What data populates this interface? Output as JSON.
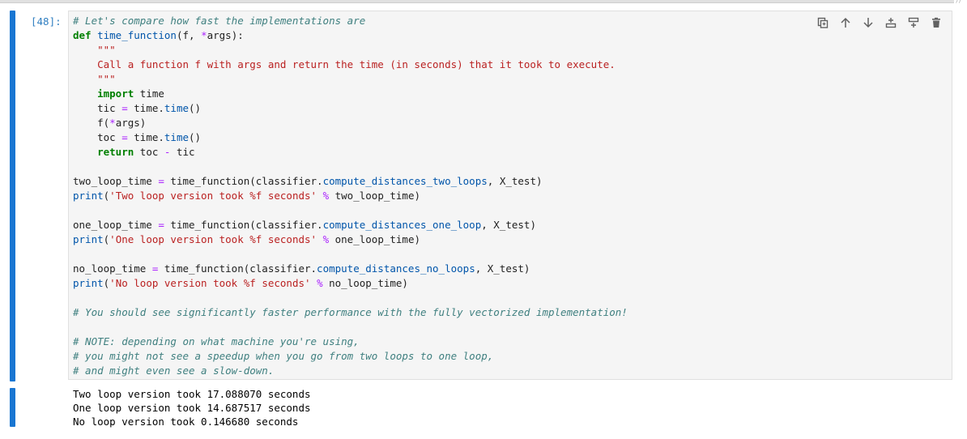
{
  "cell": {
    "prompt": "[48]:",
    "code_lines": [
      [
        {
          "t": "c",
          "v": "# Let's compare how fast the implementations are"
        }
      ],
      [
        {
          "t": "k",
          "v": "def"
        },
        {
          "t": "n",
          "v": " "
        },
        {
          "t": "f",
          "v": "time_function"
        },
        {
          "t": "n",
          "v": "(f, "
        },
        {
          "t": "o",
          "v": "*"
        },
        {
          "t": "n",
          "v": "args):"
        }
      ],
      [
        {
          "t": "s",
          "v": "    \"\"\""
        }
      ],
      [
        {
          "t": "s",
          "v": "    Call a function f with args and return the time (in seconds) that it took to execute."
        }
      ],
      [
        {
          "t": "s",
          "v": "    \"\"\""
        }
      ],
      [
        {
          "t": "n",
          "v": "    "
        },
        {
          "t": "k",
          "v": "import"
        },
        {
          "t": "n",
          "v": " time"
        }
      ],
      [
        {
          "t": "n",
          "v": "    tic "
        },
        {
          "t": "o",
          "v": "="
        },
        {
          "t": "n",
          "v": " time."
        },
        {
          "t": "f",
          "v": "time"
        },
        {
          "t": "n",
          "v": "()"
        }
      ],
      [
        {
          "t": "n",
          "v": "    f("
        },
        {
          "t": "o",
          "v": "*"
        },
        {
          "t": "n",
          "v": "args)"
        }
      ],
      [
        {
          "t": "n",
          "v": "    toc "
        },
        {
          "t": "o",
          "v": "="
        },
        {
          "t": "n",
          "v": " time."
        },
        {
          "t": "f",
          "v": "time"
        },
        {
          "t": "n",
          "v": "()"
        }
      ],
      [
        {
          "t": "n",
          "v": "    "
        },
        {
          "t": "k",
          "v": "return"
        },
        {
          "t": "n",
          "v": " toc "
        },
        {
          "t": "o",
          "v": "-"
        },
        {
          "t": "n",
          "v": " tic"
        }
      ],
      [
        {
          "t": "n",
          "v": ""
        }
      ],
      [
        {
          "t": "n",
          "v": "two_loop_time "
        },
        {
          "t": "o",
          "v": "="
        },
        {
          "t": "n",
          "v": " time_function(classifier."
        },
        {
          "t": "f",
          "v": "compute_distances_two_loops"
        },
        {
          "t": "n",
          "v": ", X_test)"
        }
      ],
      [
        {
          "t": "f",
          "v": "print"
        },
        {
          "t": "n",
          "v": "("
        },
        {
          "t": "s",
          "v": "'Two loop version took %f seconds'"
        },
        {
          "t": "n",
          "v": " "
        },
        {
          "t": "o",
          "v": "%"
        },
        {
          "t": "n",
          "v": " two_loop_time)"
        }
      ],
      [
        {
          "t": "n",
          "v": ""
        }
      ],
      [
        {
          "t": "n",
          "v": "one_loop_time "
        },
        {
          "t": "o",
          "v": "="
        },
        {
          "t": "n",
          "v": " time_function(classifier."
        },
        {
          "t": "f",
          "v": "compute_distances_one_loop"
        },
        {
          "t": "n",
          "v": ", X_test)"
        }
      ],
      [
        {
          "t": "f",
          "v": "print"
        },
        {
          "t": "n",
          "v": "("
        },
        {
          "t": "s",
          "v": "'One loop version took %f seconds'"
        },
        {
          "t": "n",
          "v": " "
        },
        {
          "t": "o",
          "v": "%"
        },
        {
          "t": "n",
          "v": " one_loop_time)"
        }
      ],
      [
        {
          "t": "n",
          "v": ""
        }
      ],
      [
        {
          "t": "n",
          "v": "no_loop_time "
        },
        {
          "t": "o",
          "v": "="
        },
        {
          "t": "n",
          "v": " time_function(classifier."
        },
        {
          "t": "f",
          "v": "compute_distances_no_loops"
        },
        {
          "t": "n",
          "v": ", X_test)"
        }
      ],
      [
        {
          "t": "f",
          "v": "print"
        },
        {
          "t": "n",
          "v": "("
        },
        {
          "t": "s",
          "v": "'No loop version took %f seconds'"
        },
        {
          "t": "n",
          "v": " "
        },
        {
          "t": "o",
          "v": "%"
        },
        {
          "t": "n",
          "v": " no_loop_time)"
        }
      ],
      [
        {
          "t": "n",
          "v": ""
        }
      ],
      [
        {
          "t": "c",
          "v": "# You should see significantly faster performance with the fully vectorized implementation!"
        }
      ],
      [
        {
          "t": "n",
          "v": ""
        }
      ],
      [
        {
          "t": "c",
          "v": "# NOTE: depending on what machine you're using,"
        }
      ],
      [
        {
          "t": "c",
          "v": "# you might not see a speedup when you go from two loops to one loop,"
        }
      ],
      [
        {
          "t": "c",
          "v": "# and might even see a slow-down."
        }
      ]
    ]
  },
  "toolbar": {
    "buttons": [
      {
        "name": "duplicate-cell-button",
        "icon": "duplicate-icon"
      },
      {
        "name": "move-up-button",
        "icon": "arrow-up-icon"
      },
      {
        "name": "move-down-button",
        "icon": "arrow-down-icon"
      },
      {
        "name": "insert-above-button",
        "icon": "insert-above-icon"
      },
      {
        "name": "insert-below-button",
        "icon": "insert-below-icon"
      },
      {
        "name": "delete-cell-button",
        "icon": "trash-icon"
      }
    ]
  },
  "output": {
    "lines": [
      "Two loop version took 17.088070 seconds",
      "One loop version took 14.687517 seconds",
      "No loop version took 0.146680 seconds"
    ]
  },
  "colors": {
    "accent": "#1976d2",
    "prompt": "#307fc1",
    "comment": "#408080",
    "keyword": "#008000",
    "string": "#ba2121",
    "function": "#0055aa",
    "operator": "#aa22ff"
  }
}
